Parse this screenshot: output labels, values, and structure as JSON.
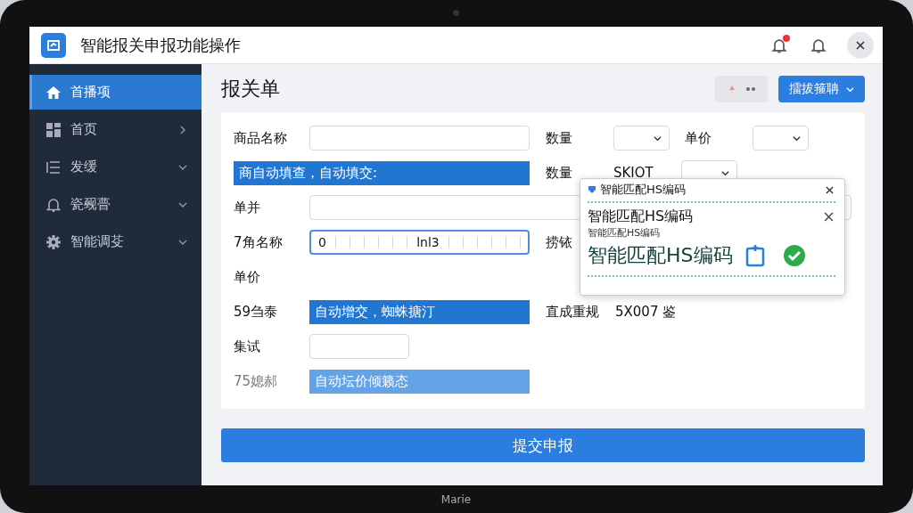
{
  "app": {
    "title": "智能报关申报功能操作",
    "notification_badge": true
  },
  "sidebar": {
    "items": [
      {
        "label": "首播项",
        "kind": "home",
        "selected": true
      },
      {
        "label": "首页",
        "kind": "grid",
        "selected": false
      },
      {
        "label": "发缓",
        "kind": "list",
        "selected": false
      },
      {
        "label": "瓷觋瞢",
        "kind": "bell",
        "selected": false
      },
      {
        "label": "智能调芟",
        "kind": "gear",
        "selected": false
      }
    ]
  },
  "page": {
    "title": "报关单",
    "primary_button": "擂拔箍聃"
  },
  "form": {
    "rows": [
      {
        "label": "商品名称",
        "field": {
          "kind": "input"
        },
        "right": [
          {
            "kind": "label",
            "text": "数量"
          },
          {
            "kind": "select"
          },
          {
            "kind": "label",
            "text": "单价"
          },
          {
            "kind": "select"
          }
        ]
      },
      {
        "field": {
          "kind": "banner",
          "text": "商自动填查，自动填交:"
        },
        "right": [
          {
            "kind": "label",
            "text": "数量"
          },
          {
            "kind": "label",
            "text": "SKIOT"
          },
          {
            "kind": "select"
          }
        ]
      },
      {
        "label": "单并",
        "field": {
          "kind": "input_wide"
        }
      },
      {
        "label": "7角名称",
        "field": {
          "kind": "segmented",
          "value": "0",
          "code": "lnl3"
        },
        "right": [
          {
            "kind": "label",
            "text": "捞铱"
          }
        ]
      },
      {
        "label": "单价"
      },
      {
        "label": "59刍泰",
        "field": {
          "kind": "banner",
          "text": "自动增交，蜘蛛搪汀"
        },
        "right": [
          {
            "kind": "label",
            "text": "直成重规"
          },
          {
            "kind": "label",
            "text": "5X007 鉴"
          }
        ]
      },
      {
        "label": "集试",
        "field": {
          "kind": "input_short"
        }
      },
      {
        "label": "75媳郝",
        "muted": true,
        "field": {
          "kind": "banner_light",
          "text": "自动坛价倾籁态"
        }
      }
    ]
  },
  "popup": {
    "header": "智能匹配HS编码",
    "title": "智能匹配HS编码",
    "subtitle": "智能匹配HS编码",
    "result": "智能匹配HS编码"
  },
  "submit_button": "提交申报",
  "device": {
    "label": "Marie"
  }
}
